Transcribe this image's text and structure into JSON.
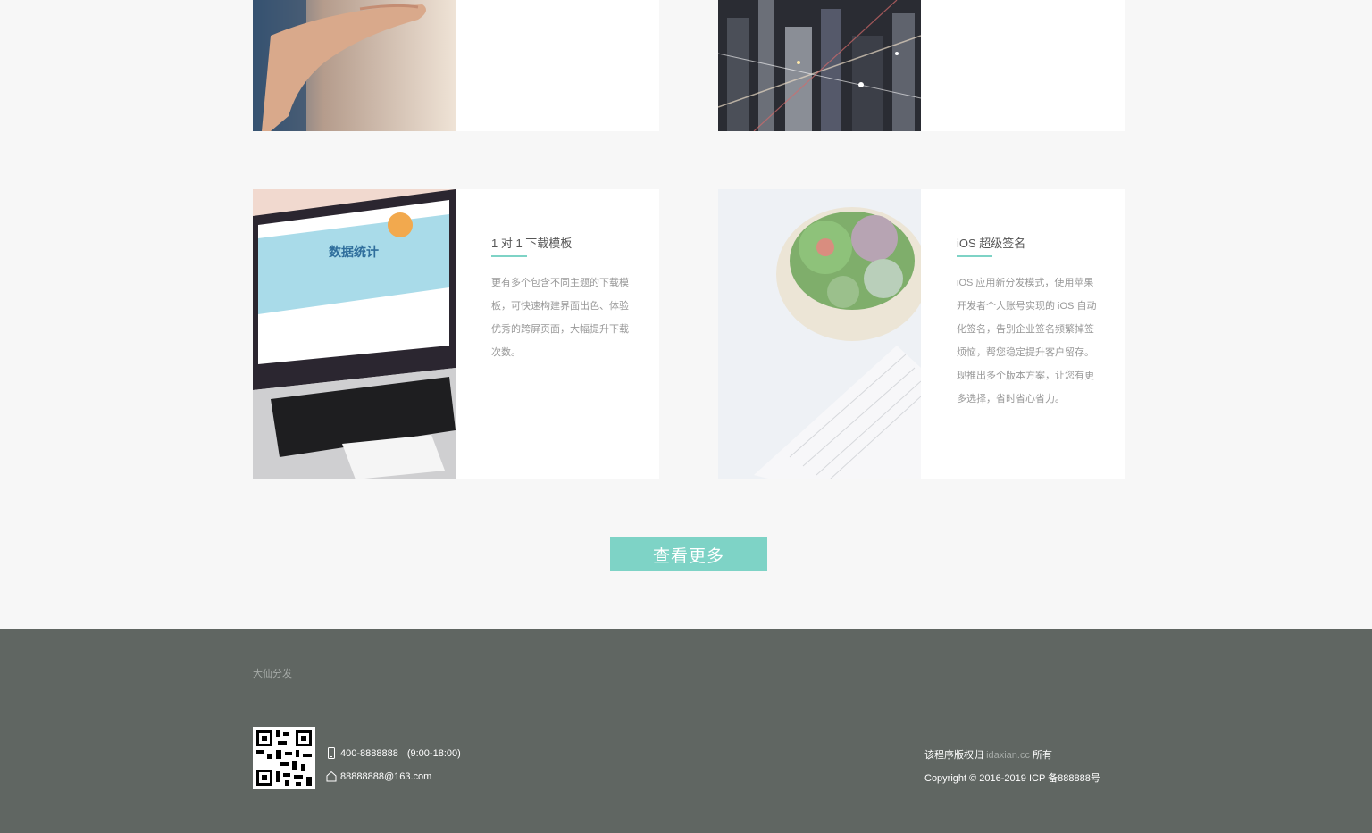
{
  "cards": [
    {
      "title": "",
      "description": "",
      "image": "hand-photo"
    },
    {
      "title": "",
      "description": "",
      "image": "city-night-photo"
    },
    {
      "title": "1 对 1 下载模板",
      "description": "更有多个包含不同主题的下载模板，可快速构建界面出色、体验优秀的跨屏页面，大幅提升下载次数。",
      "image": "laptop-photo"
    },
    {
      "title": "iOS 超级签名",
      "description": "iOS 应用新分发模式，使用苹果开发者个人账号实现的 iOS 自动化签名，告别企业签名频繁掉签烦恼，帮您稳定提升客户留存。 现推出多个版本方案，让您有更多选择，省时省心省力。",
      "image": "succulent-keyboard-photo"
    }
  ],
  "laptop_screen": {
    "line1": "数据统计",
    "line2": "数据统计"
  },
  "more_button": {
    "label": "查看更多"
  },
  "footer": {
    "brand": "大仙分发",
    "phone": "400-8888888",
    "hours": "(9:00-18:00)",
    "email": "88888888@163.com",
    "rights_prefix": "该程序版权归",
    "rights_domain": "idaxian.cc",
    "rights_suffix": "所有",
    "copyright": "Copyright © 2016-2019  ICP 备888888号"
  },
  "colors": {
    "accent": "#7ed3c6",
    "footer_bg": "#606662",
    "page_bg": "#f7f7f7"
  }
}
